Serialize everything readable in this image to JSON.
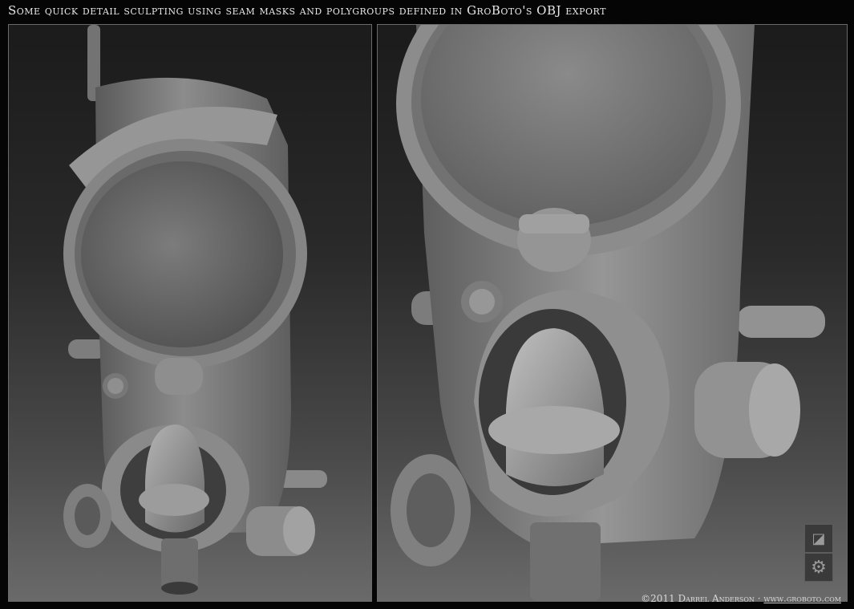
{
  "caption": "Some quick detail sculpting using seam masks and polygroups defined in GroBoto's OBJ export",
  "footer": {
    "copyright": "©2011 Darrel Anderson",
    "separator": " · ",
    "link": "www.groboto.com"
  },
  "panels": [
    {
      "view": "front-three-quarter"
    },
    {
      "view": "close-up"
    }
  ],
  "icons": {
    "logo": "groboto-logo-icon",
    "gear": "gear-icon"
  }
}
